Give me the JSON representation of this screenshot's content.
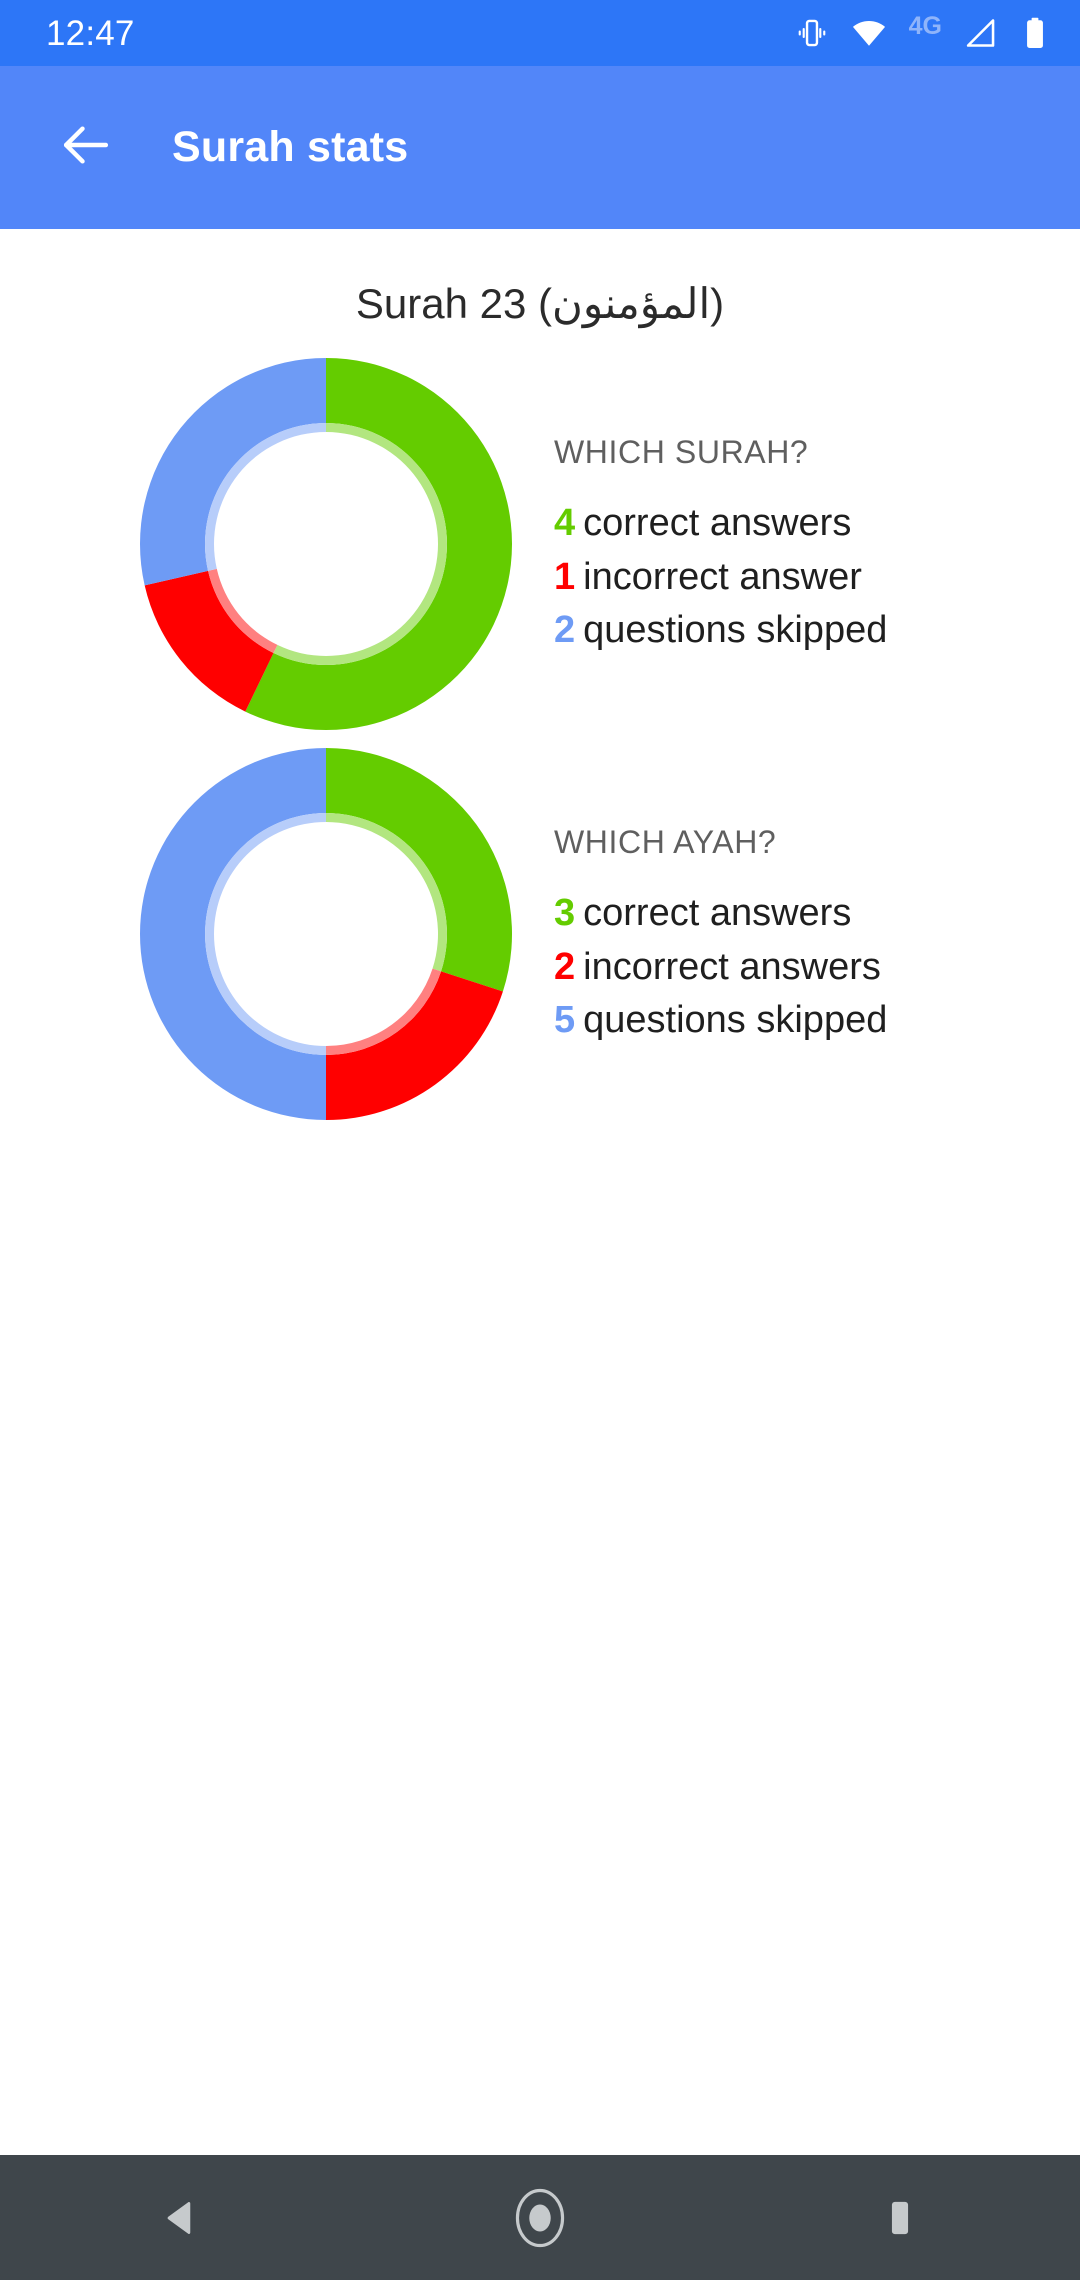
{
  "status_bar": {
    "clock": "12:47",
    "network_label": "4G",
    "icons": [
      "vibrate-icon",
      "wifi-icon",
      "signal-icon",
      "battery-icon"
    ],
    "background_color": "#2D76F7",
    "text_color": "#FFFFFF"
  },
  "app_bar": {
    "title": "Surah stats",
    "back_icon": "arrow-left-icon",
    "background_color": "#5286F9",
    "text_color": "#FFFFFF"
  },
  "page": {
    "title": "Surah 23 (المؤمنون)"
  },
  "colors": {
    "correct": "#64CC00",
    "incorrect": "#FF0000",
    "skipped": "#6E9BF5",
    "correct_light": "#A6E06B",
    "incorrect_light": "#FF8080",
    "skipped_light": "#AFC8FA",
    "heading": "#5F5F5F",
    "body_text": "#1F1F1F"
  },
  "sections": [
    {
      "heading": "WHICH SURAH?",
      "rows": [
        {
          "count": "4",
          "label": "correct answers",
          "kind": "correct"
        },
        {
          "count": "1",
          "label": "incorrect answer",
          "kind": "incorrect"
        },
        {
          "count": "2",
          "label": "questions skipped",
          "kind": "skipped"
        }
      ]
    },
    {
      "heading": "WHICH AYAH?",
      "rows": [
        {
          "count": "3",
          "label": "correct answers",
          "kind": "correct"
        },
        {
          "count": "2",
          "label": "incorrect answers",
          "kind": "incorrect"
        },
        {
          "count": "5",
          "label": "questions skipped",
          "kind": "skipped"
        }
      ]
    }
  ],
  "chart_data": [
    {
      "type": "pie",
      "title": "WHICH SURAH?",
      "variant": "donut",
      "start_angle_deg": 0,
      "direction": "clockwise",
      "total": 7,
      "categories": [
        "correct answers",
        "incorrect answers",
        "questions skipped"
      ],
      "values": [
        4,
        1,
        2
      ],
      "colors": [
        "#64CC00",
        "#FF0000",
        "#6E9BF5"
      ],
      "legend_position": "right"
    },
    {
      "type": "pie",
      "title": "WHICH AYAH?",
      "variant": "donut",
      "start_angle_deg": 0,
      "direction": "clockwise",
      "total": 10,
      "categories": [
        "correct answers",
        "incorrect answers",
        "questions skipped"
      ],
      "values": [
        3,
        2,
        5
      ],
      "colors": [
        "#64CC00",
        "#FF0000",
        "#6E9BF5"
      ],
      "legend_position": "right"
    }
  ],
  "nav_bar": {
    "background_color": "#3F464B",
    "buttons": [
      {
        "name": "back-nav-button",
        "icon": "triangle-back-icon"
      },
      {
        "name": "home-nav-button",
        "icon": "circle-home-icon"
      },
      {
        "name": "recents-nav-button",
        "icon": "square-recents-icon"
      }
    ]
  }
}
